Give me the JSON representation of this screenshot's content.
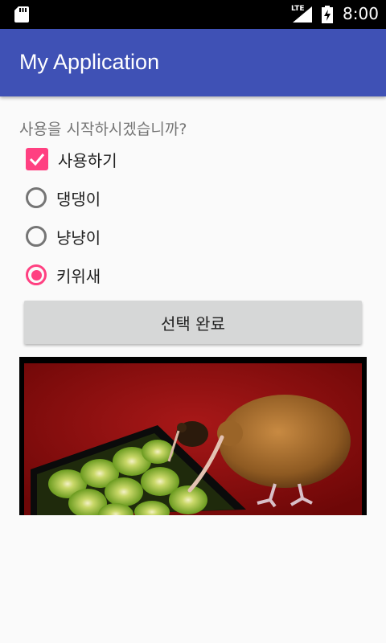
{
  "status_bar": {
    "network": "LTE",
    "time": "8:00"
  },
  "app_bar": {
    "title": "My Application"
  },
  "form": {
    "question": "사용을 시작하시겠습니까?",
    "checkbox": {
      "label": "사용하기",
      "checked": true
    },
    "radios": [
      {
        "label": "댕댕이",
        "checked": false
      },
      {
        "label": "냥냥이",
        "checked": false
      },
      {
        "label": "키위새",
        "checked": true
      }
    ],
    "submit_label": "선택 완료"
  },
  "colors": {
    "primary": "#3f51b5",
    "accent": "#ff4081",
    "status_bar": "#000000",
    "background": "#fafafa"
  }
}
